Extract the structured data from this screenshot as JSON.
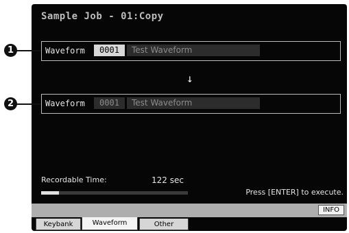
{
  "title": "Sample Job - 01:Copy",
  "source": {
    "label": "Waveform",
    "number": "0001",
    "name": "Test Waveform"
  },
  "destination": {
    "label": "Waveform",
    "number": "0001",
    "name": "Test Waveform"
  },
  "arrow": "↓",
  "recordable": {
    "label": "Recordable Time:",
    "value": "122 sec",
    "fill_fraction": 0.12
  },
  "prompt": "Press [ENTER] to execute.",
  "info_button": "INFO",
  "tabs": [
    {
      "label": "Keybank"
    },
    {
      "label": "Waveform"
    },
    {
      "label": "Other"
    }
  ],
  "callouts": [
    "1",
    "2"
  ]
}
